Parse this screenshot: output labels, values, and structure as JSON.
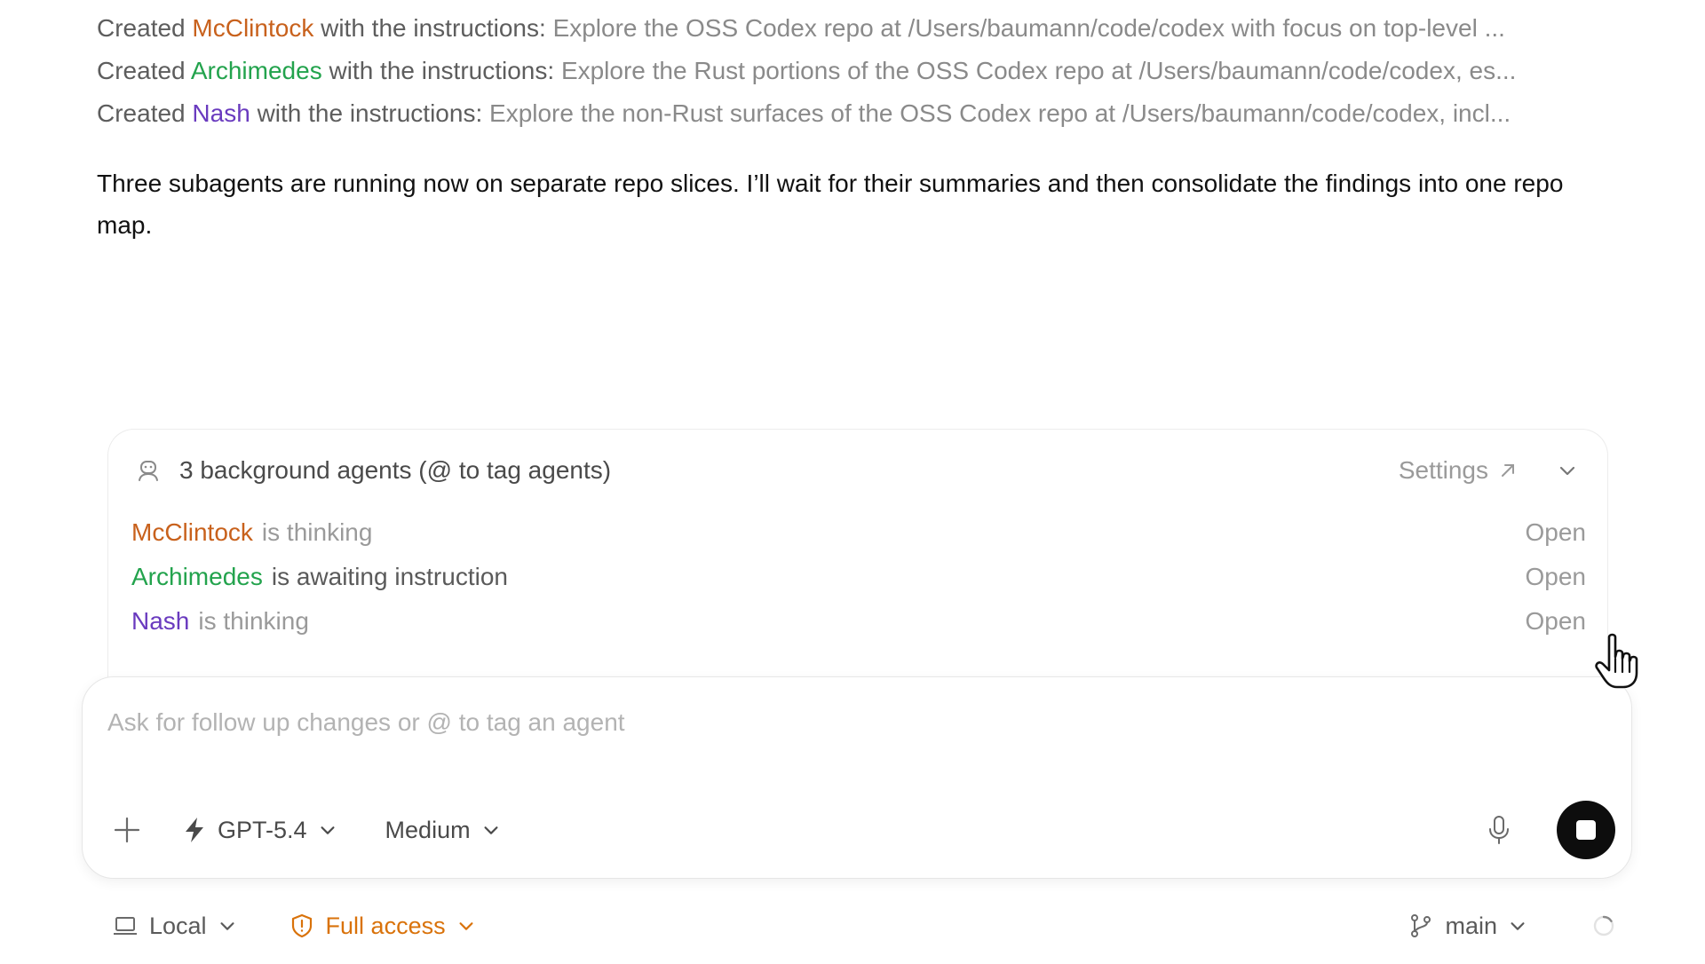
{
  "colors": {
    "mcclintock": "#c8611c",
    "archimedes": "#23a34d",
    "nash": "#6a3bbf",
    "full_access": "#d9720a"
  },
  "transcript": {
    "lines": [
      {
        "prefix": "Created",
        "agent": "McClintock",
        "middle": "with the instructions:",
        "instructions": "Explore the OSS Codex repo at /Users/baumann/code/codex with focus on top-level ..."
      },
      {
        "prefix": "Created",
        "agent": "Archimedes",
        "middle": "with the instructions:",
        "instructions": "Explore the Rust portions of the OSS Codex repo at /Users/baumann/code/codex, es..."
      },
      {
        "prefix": "Created",
        "agent": "Nash",
        "middle": "with the instructions:",
        "instructions": "Explore the non-Rust surfaces of the OSS Codex repo at /Users/baumann/code/codex, incl..."
      }
    ],
    "message": "Three subagents are running now on separate repo slices. I’ll wait for their summaries and then consolidate the findings into one repo map."
  },
  "agents_panel": {
    "icon": "robot-icon",
    "title": "3 background agents (@ to tag agents)",
    "settings_label": "Settings",
    "settings_icon": "external-arrow-icon",
    "collapse_icon": "chevron-down-icon",
    "agents": [
      {
        "name": "McClintock",
        "status": "is thinking",
        "open_label": "Open"
      },
      {
        "name": "Archimedes",
        "status": "is awaiting instruction",
        "open_label": "Open"
      },
      {
        "name": "Nash",
        "status": "is thinking",
        "open_label": "Open"
      }
    ]
  },
  "composer": {
    "placeholder": "Ask for follow up changes or @ to tag an agent",
    "value": "",
    "add_icon": "plus-icon",
    "model_icon": "bolt-icon",
    "model_label": "GPT-5.4",
    "effort_label": "Medium",
    "mic_icon": "microphone-icon",
    "stop_icon": "stop-icon"
  },
  "footer": {
    "environment_icon": "laptop-icon",
    "environment_label": "Local",
    "access_icon": "shield-alert-icon",
    "access_label": "Full access",
    "branch_icon": "git-branch-icon",
    "branch_label": "main",
    "status_icon": "spinner-icon"
  }
}
